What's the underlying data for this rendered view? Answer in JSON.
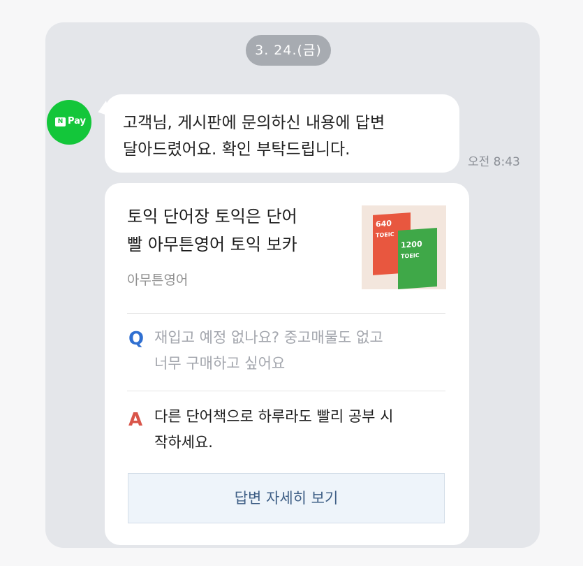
{
  "date_separator": "3. 24.(금)",
  "sender": {
    "avatar_n": "N",
    "avatar_pay": "Pay",
    "brand_color": "#13c63a"
  },
  "message": {
    "line1": "고객님, 게시판에 문의하신 내용에 답변",
    "line2": "달아드렸어요. 확인 부탁드립니다.",
    "time": "오전 8:43"
  },
  "card": {
    "product_title_line1": "토익 단어장 토익은 단어",
    "product_title_line2": "빨 아무튼영어 토익 보카",
    "product_source": "아무튼영어",
    "thumbnail": {
      "book1_number": "640",
      "book1_label": "TOEIC",
      "book2_number": "1200",
      "book2_label": "TOEIC"
    },
    "question_mark": "Q",
    "question_line1": "재입고 예정 없나요? 중고매물도 없고",
    "question_line2": "너무 구매하고 싶어요",
    "answer_mark": "A",
    "answer_line1": "다른 단어책으로 하루라도 빨리 공부 시",
    "answer_line2": "작하세요.",
    "detail_button": "답변 자세히 보기"
  }
}
